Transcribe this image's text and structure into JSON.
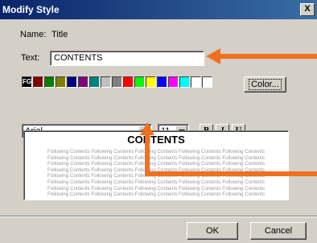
{
  "window": {
    "title": "Modify Style",
    "close_label": "X"
  },
  "name": {
    "label": "Name:",
    "value": "Title"
  },
  "text": {
    "label": "Text:",
    "value": "CONTENTS"
  },
  "colors": {
    "fg_label": "FG",
    "swatches": [
      "#800000",
      "#008000",
      "#808000",
      "#000080",
      "#800080",
      "#008080",
      "#c0c0c0",
      "#808080",
      "#ff0000",
      "#00ff00",
      "#ffff00",
      "#0000ff",
      "#ff00ff",
      "#00ffff",
      "#ffffff",
      "#ffffff"
    ],
    "color_button_label": "Color..."
  },
  "font": {
    "family": "Arial",
    "size": "11"
  },
  "format": {
    "bold_label": "B",
    "italic_label": "I",
    "underline_label": "U"
  },
  "preview": {
    "title": "CONTENTS",
    "body": "Following Contents Following Contents Following Contents Following Contents Following Contents Following Contents Following Contents Following Contents Following Contents Following Contents Following Contents Following Contents Following Contents Following Contents Following Contents Following Contents Following Contents Following Contents Following Contents Following Contents Following Contents Following Contents Following Contents Following Contents Following Contents Following Contents Following Contents Following Contents Following Contents Following Contents Following Contents Following Contents Following Contents Following Contents Following Contents Following Contents Following Contents Following Contents Following Contents Following Contents"
  },
  "buttons": {
    "ok": "OK",
    "cancel": "Cancel"
  },
  "annotation_color": "#f07020"
}
